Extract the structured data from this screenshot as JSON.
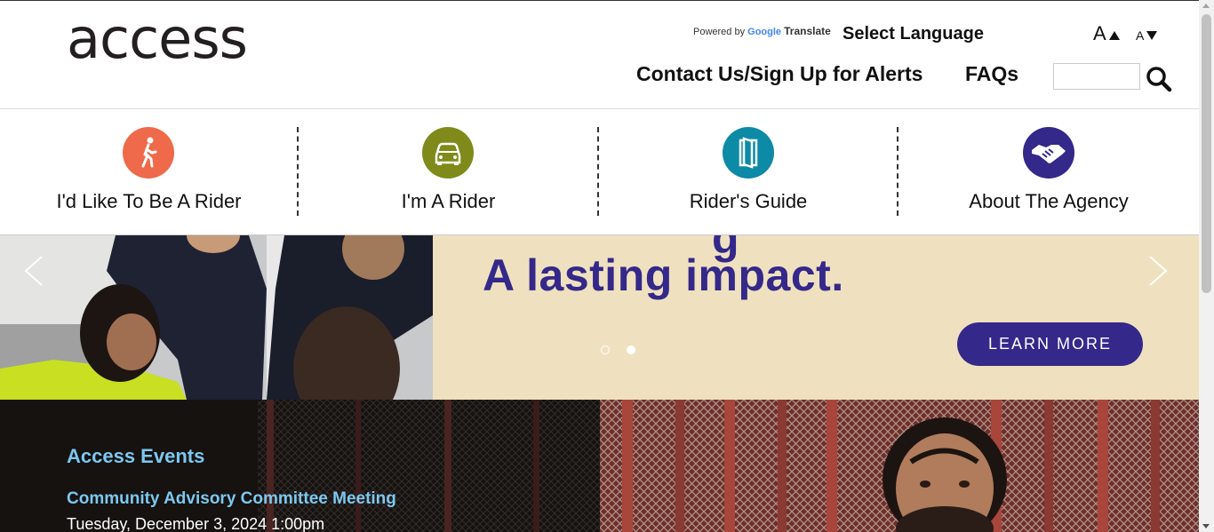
{
  "header": {
    "logo_text": "access",
    "powered_by": "Powered by",
    "google": "Google",
    "translate": "Translate",
    "select_language": "Select Language",
    "font_increase": "A",
    "font_decrease": "A",
    "nav": {
      "contact": "Contact Us/Sign Up for Alerts",
      "faqs": "FAQs"
    },
    "search_placeholder": ""
  },
  "audience_nav": [
    {
      "label": "I'd Like To Be A Rider",
      "icon": "walking-person-icon",
      "color": "#ee6a4a"
    },
    {
      "label": "I'm A Rider",
      "icon": "vehicle-icon",
      "color": "#7f8a1a"
    },
    {
      "label": "Rider's Guide",
      "icon": "guide-book-icon",
      "color": "#0d8aa6"
    },
    {
      "label": "About The Agency",
      "icon": "handshake-icon",
      "color": "#34288a"
    }
  ],
  "hero": {
    "headline": "A lasting impact.",
    "button_label": "LEARN MORE",
    "slides": 2,
    "active_slide": 2,
    "accent_color": "#34288a",
    "background_color": "#efe1bf"
  },
  "events": {
    "title": "Access Events",
    "items": [
      {
        "name": "Community Advisory Committee Meeting",
        "date": "Tuesday, December 3, 2024 1:00pm"
      }
    ]
  }
}
